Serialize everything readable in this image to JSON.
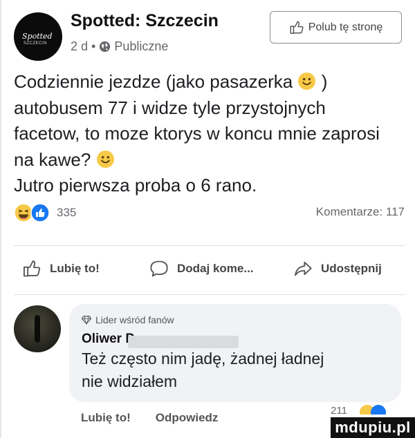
{
  "post": {
    "page_name": "Spotted: Szczecin",
    "avatar_logo_text": "Spotted",
    "avatar_logo_sub": "SZCZECIN",
    "time": "2 d",
    "separator": "•",
    "audience": "Publiczne",
    "follow_label": "Polub tę stronę",
    "text_lines": [
      "Codziennie jezdze (jako pasazerka",
      ")",
      "autobusem 77 i widze tyle przystojnych",
      "facetow, to moze ktorys w koncu mnie zaprosi",
      "na kawe?",
      "Jutro pierwsza proba o 6 rano."
    ]
  },
  "reactions": {
    "count": "335",
    "comments": "Komentarze: 117"
  },
  "actions": {
    "like": "Lubię to!",
    "comment": "Dodaj kome...",
    "share": "Udostępnij"
  },
  "comment": {
    "badge": "Lider wśród fanów",
    "author": "Oliwer Р",
    "text_lines": [
      "Też często nim jadę, żadnej ładnej",
      "nie widziałem"
    ],
    "like": "Lubię to!",
    "reply": "Odpowiedz",
    "reaction_count": "211"
  },
  "watermark": "mdupiu.pl",
  "colors": {
    "like_blue": "#1877f2",
    "emoji_yellow": "#f7c948",
    "bubble": "#f0f2f5",
    "secondary_text": "#65676b"
  },
  "icons": [
    "globe-icon",
    "thumbs-up-icon",
    "speech-bubble-icon",
    "share-arrow-icon",
    "smile-emoji-icon",
    "laugh-emoji-icon",
    "diamond-icon"
  ]
}
